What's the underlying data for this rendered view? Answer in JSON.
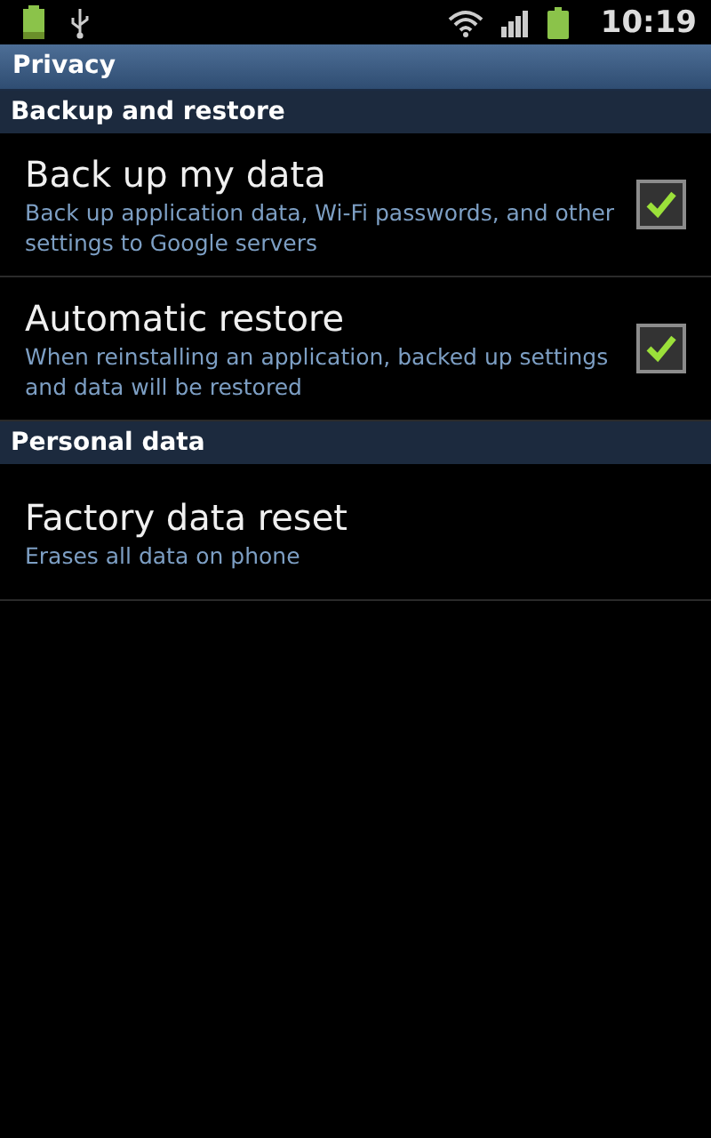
{
  "status_bar": {
    "time": "10:19"
  },
  "title": "Privacy",
  "sections": [
    {
      "header": "Backup and restore",
      "items": [
        {
          "kind": "checkbox",
          "title": "Back up my data",
          "summary": "Back up application data, Wi-Fi passwords, and other settings to Google servers",
          "checked": true
        },
        {
          "kind": "checkbox",
          "title": "Automatic restore",
          "summary": "When reinstalling an application, backed up settings and data will be restored",
          "checked": true
        }
      ]
    },
    {
      "header": "Personal data",
      "items": [
        {
          "kind": "plain",
          "title": "Factory data reset",
          "summary": "Erases all data on phone"
        }
      ]
    }
  ]
}
